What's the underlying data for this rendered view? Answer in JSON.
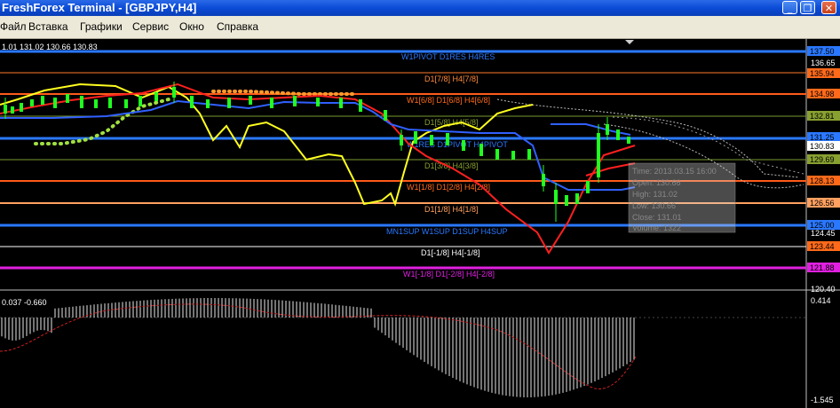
{
  "window": {
    "title": "FreshForex Terminal - [GBPJPY,H4]",
    "buttons": [
      "_",
      "❐",
      "✕"
    ]
  },
  "menu": [
    "Файл",
    "Вставка",
    "Графики",
    "Сервис",
    "Окно",
    "Справка"
  ],
  "ohlc_readout": "1.01 131.02 130.66 130.83",
  "indicator_readout": "0.037 -0.660",
  "price_scale": {
    "labels": [
      "137.50",
      "136.65",
      "135.94",
      "134.98",
      "132.81",
      "131.25",
      "130.83",
      "129.69",
      "128.13",
      "126.56",
      "125.00",
      "124.45",
      "123.44",
      "121.88",
      "120.40"
    ],
    "highlighted": [
      {
        "label": "137.50",
        "color": "#2a78ff"
      },
      {
        "label": "135.94",
        "color": "#ff6a1a"
      },
      {
        "label": "134.98",
        "color": "#ff6a1a"
      },
      {
        "label": "132.81",
        "color": "#88a030"
      },
      {
        "label": "131.25",
        "color": "#2a78ff"
      },
      {
        "label": "130.83",
        "color": "#ffffff"
      },
      {
        "label": "129.69",
        "color": "#88a030"
      },
      {
        "label": "128.13",
        "color": "#ff6a1a"
      },
      {
        "label": "126.56",
        "color": "#ffa060"
      },
      {
        "label": "125.00",
        "color": "#2a78ff"
      },
      {
        "label": "123.44",
        "color": "#ff6a1a"
      },
      {
        "label": "121.88",
        "color": "#e020e0"
      }
    ]
  },
  "indicator_scale": [
    "0.414",
    "-1.545"
  ],
  "level_labels": [
    {
      "text": "W1PIVOT D1RES H4RES",
      "color": "#2a78ff"
    },
    {
      "text": "D1[7/8] H4[7/8]",
      "color": "#ff8a3a"
    },
    {
      "text": "W1[6/8] D1[6/8] H4[6/8]",
      "color": "#ff6a1a"
    },
    {
      "text": "D1[5/8] H4[5/8]",
      "color": "#88a030"
    },
    {
      "text": "W1RES D1PIVOT H4PIVOT",
      "color": "#2a78ff"
    },
    {
      "text": "D1[3/8] H4[3/8]",
      "color": "#88a030"
    },
    {
      "text": "W1[1/8] D1[2/8] H4[2/8]",
      "color": "#ff6a1a"
    },
    {
      "text": "D1[1/8] H4[1/8]",
      "color": "#ffa060"
    },
    {
      "text": "MN1SUP W1SUP D1SUP H4SUP",
      "color": "#2a78ff"
    },
    {
      "text": "D1[-1/8] H4[-1/8]",
      "color": "#ffffff"
    },
    {
      "text": "W1[-1/8] D1[-2/8] H4[-2/8]",
      "color": "#e020e0"
    }
  ],
  "tooltip": [
    "Time: 2013.03.15 16:00",
    "Open: 130.66",
    "High: 131.02",
    "Low: 130.66",
    "Close: 131.01",
    "Volume: 1322"
  ]
}
